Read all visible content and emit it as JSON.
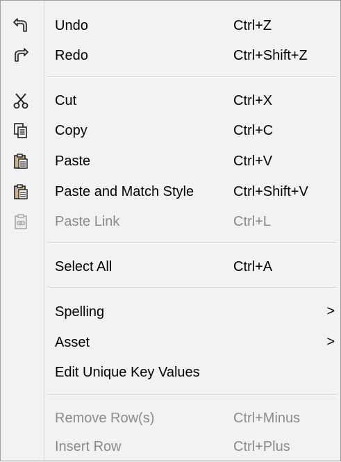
{
  "menu": {
    "items": [
      {
        "label": "Undo",
        "shortcut": "Ctrl+Z",
        "icon": "undo-icon",
        "enabled": true
      },
      {
        "label": "Redo",
        "shortcut": "Ctrl+Shift+Z",
        "icon": "redo-icon",
        "enabled": true
      },
      {
        "label": "Cut",
        "shortcut": "Ctrl+X",
        "icon": "scissors-icon",
        "enabled": true
      },
      {
        "label": "Copy",
        "shortcut": "Ctrl+C",
        "icon": "copy-icon",
        "enabled": true
      },
      {
        "label": "Paste",
        "shortcut": "Ctrl+V",
        "icon": "clipboard-icon",
        "enabled": true
      },
      {
        "label": "Paste and Match Style",
        "shortcut": "Ctrl+Shift+V",
        "icon": "clipboard-icon",
        "enabled": true
      },
      {
        "label": "Paste Link",
        "shortcut": "Ctrl+L",
        "icon": "clipboard-link-icon",
        "enabled": false
      },
      {
        "label": "Select All",
        "shortcut": "Ctrl+A",
        "enabled": true
      },
      {
        "label": "Spelling",
        "submenu_arrow": ">",
        "enabled": true
      },
      {
        "label": "Asset",
        "submenu_arrow": ">",
        "enabled": true
      },
      {
        "label": "Edit Unique Key Values",
        "enabled": true
      },
      {
        "label": "Remove Row(s)",
        "shortcut": "Ctrl+Minus",
        "enabled": false
      },
      {
        "label": "Insert Row",
        "shortcut": "Ctrl+Plus",
        "enabled": false
      }
    ]
  },
  "colors": {
    "background": "#f2f2f2",
    "text": "#000000",
    "disabled_text": "#8a8a8a",
    "separator": "#d0d0d0"
  }
}
